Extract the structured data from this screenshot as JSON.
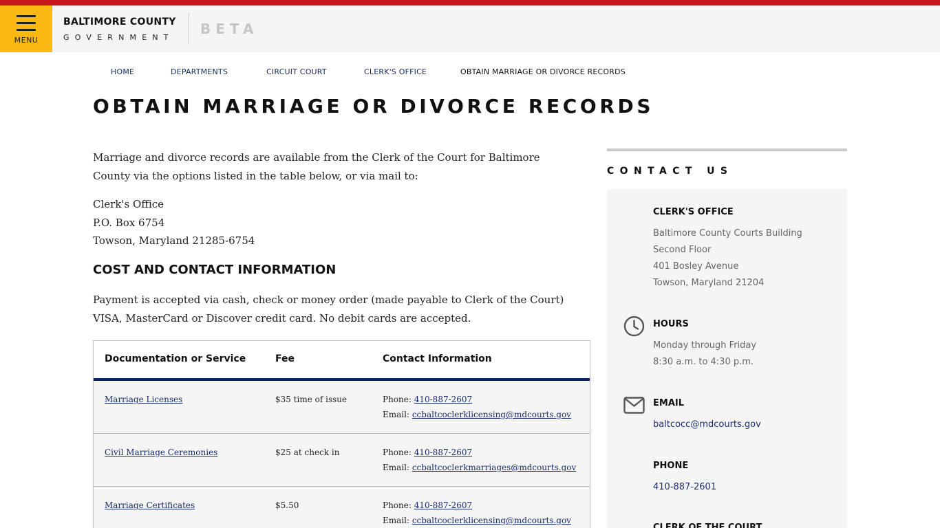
{
  "header": {
    "menu_label": "MENU",
    "brand_line1": "BALTIMORE COUNTY",
    "brand_line2": "GOVERNMENT",
    "beta_label": "BETA",
    "stripe_color": "#c8151b",
    "menu_color": "#fdb913"
  },
  "breadcrumb": {
    "items": [
      "HOME",
      "DEPARTMENTS",
      "CIRCUIT COURT",
      "CLERK'S OFFICE",
      "OBTAIN MARRIAGE OR DIVORCE RECORDS"
    ]
  },
  "page": {
    "title": "OBTAIN MARRIAGE OR DIVORCE RECORDS",
    "intro": "Marriage and divorce records are available from the Clerk of the Court for Baltimore County via the options listed in the table below, or via mail to:",
    "address": [
      "Clerk's Office",
      "P.O. Box 6754",
      "Towson, Maryland 21285-6754"
    ],
    "section_heading": "COST AND CONTACT INFORMATION",
    "payment": "Payment is accepted via cash, check or money order (made payable to Clerk of the Court) VISA, MasterCard or Discover credit card. No debit cards are accepted."
  },
  "table": {
    "headers": [
      "Documentation or Service",
      "Fee",
      "Contact Information"
    ],
    "phone_label": "Phone: ",
    "email_label": "Email: ",
    "rows": [
      {
        "service": "Marriage Licenses",
        "fee": "$35 time of issue",
        "phone": "410-887-2607",
        "email": "ccbaltcoclerklicensing@mdcourts.gov"
      },
      {
        "service": "Civil Marriage Ceremonies",
        "fee": "$25 at check in",
        "phone": "410-887-2607",
        "email": "ccbaltcoclerkmarriages@mdcourts.gov"
      },
      {
        "service": "Marriage Certificates",
        "fee": "$5.50",
        "phone": "410-887-2607",
        "email": "ccbaltcoclerklicensing@mdcourts.gov"
      }
    ],
    "header_rule_color": "#0b2361"
  },
  "sidebar": {
    "title": "CONTACT US",
    "office_heading": "CLERK'S OFFICE",
    "office_lines": [
      "Baltimore County Courts Building",
      "Second Floor",
      "401 Bosley Avenue",
      "Towson, Maryland 21204"
    ],
    "hours_heading": "HOURS",
    "hours_lines": [
      "Monday through Friday",
      "8:30 a.m. to 4:30 p.m."
    ],
    "email_heading": "EMAIL",
    "email_value": "baltcocc@mdcourts.gov",
    "phone_heading": "PHONE",
    "phone_value": "410-887-2601",
    "next_heading": "CLERK OF THE COURT",
    "icons": [
      "clock-icon",
      "envelope-icon"
    ]
  }
}
